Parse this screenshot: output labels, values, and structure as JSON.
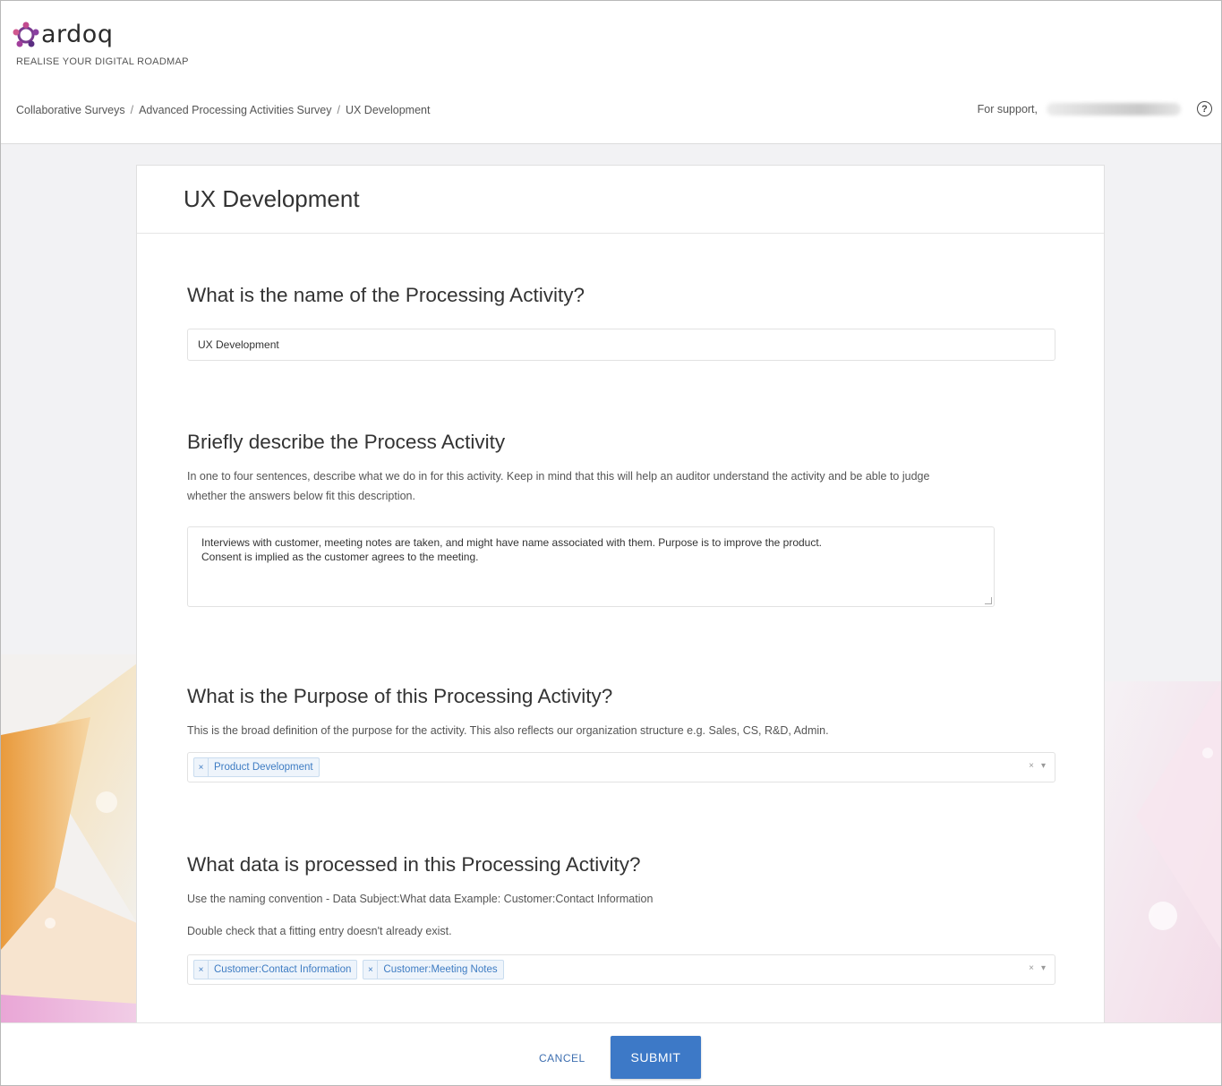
{
  "app": {
    "logo_text": "ardoq",
    "tagline": "REALISE YOUR DIGITAL ROADMAP"
  },
  "breadcrumb": [
    "Collaborative Surveys",
    "Advanced Processing Activities Survey",
    "UX Development"
  ],
  "support": {
    "label": "For support,"
  },
  "card": {
    "title": "UX Development"
  },
  "questions": {
    "name": {
      "title": "What is the name of the Processing Activity?",
      "value": "UX Development"
    },
    "describe": {
      "title": "Briefly describe the Process Activity",
      "help_line1": "In one to four sentences, describe what we do in for this activity. Keep in mind that this will help an auditor understand the activity and be able to judge",
      "help_line2": "whether the answers below fit this description.",
      "value_line1": "Interviews with customer, meeting notes are taken, and might have name associated with them. Purpose is to improve the product.",
      "value_line2": "Consent is implied as the customer agrees to the meeting."
    },
    "purpose": {
      "title": "What is the Purpose of this Processing Activity?",
      "help": "This is the broad definition of the purpose for the activity. This also reflects our organization structure e.g. Sales, CS, R&D, Admin.",
      "tags": [
        "Product Development"
      ]
    },
    "data": {
      "title": "What data is processed in this Processing Activity?",
      "help_line1": "Use the naming convention - Data Subject:What data Example: Customer:Contact Information",
      "help_line2": "Double check that a fitting entry doesn't already exist.",
      "tags": [
        "Customer:Contact Information",
        "Customer:Meeting Notes"
      ]
    }
  },
  "footer": {
    "cancel_label": "CANCEL",
    "submit_label": "SUBMIT"
  },
  "colors": {
    "accent": "#3d79c7",
    "tag_bg": "#eef4fb",
    "tag_text": "#3e7cc3"
  }
}
